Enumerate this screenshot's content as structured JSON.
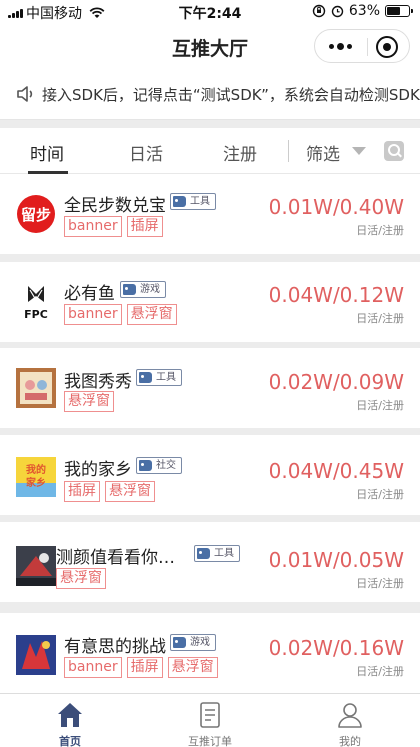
{
  "status_bar": {
    "carrier": "中国移动",
    "time": "下午2:44",
    "battery": "63%",
    "battery_level": 0.63
  },
  "nav": {
    "title": "互推大厅"
  },
  "notice": {
    "text": "接入SDK后，记得点击“测试SDK”，系统会自动检测SDK是否接入成功"
  },
  "filter": {
    "tabs": [
      "时间",
      "日活",
      "注册",
      "筛选"
    ],
    "active_tab": "时间"
  },
  "apps": [
    {
      "name": "全民步数兑宝",
      "category": "工具",
      "tags": [
        "banner",
        "插屏"
      ],
      "price": "0.01W/0.40W",
      "price_sub": "日活/注册"
    },
    {
      "name": "必有鱼",
      "category": "游戏",
      "tags": [
        "banner",
        "悬浮窗"
      ],
      "price": "0.04W/0.12W",
      "price_sub": "日活/注册"
    },
    {
      "name": "我图秀秀",
      "category": "工具",
      "tags": [
        "悬浮窗"
      ],
      "price": "0.02W/0.09W",
      "price_sub": "日活/注册"
    },
    {
      "name": "我的家乡",
      "category": "社交",
      "tags": [
        "插屏",
        "悬浮窗"
      ],
      "price": "0.04W/0.45W",
      "price_sub": "日活/注册"
    },
    {
      "name": "测颜值看看你…",
      "category": "工具",
      "tags": [
        "悬浮窗"
      ],
      "price": "0.01W/0.05W",
      "price_sub": "日活/注册"
    },
    {
      "name": "有意思的挑战",
      "category": "游戏",
      "tags": [
        "banner",
        "插屏",
        "悬浮窗"
      ],
      "price": "0.02W/0.16W",
      "price_sub": "日活/注册"
    }
  ],
  "icon_texts": {
    "app1": "留步",
    "app2": "FPC",
    "app4_top": "我的",
    "app4_bottom": "家乡"
  },
  "tab_bar": {
    "items": [
      "首页",
      "互推订单",
      "我的"
    ],
    "active": "首页"
  },
  "colors": {
    "price": "#e06060",
    "tag_border": "#ef8f8f",
    "tab_active": "#3c4e7a"
  }
}
